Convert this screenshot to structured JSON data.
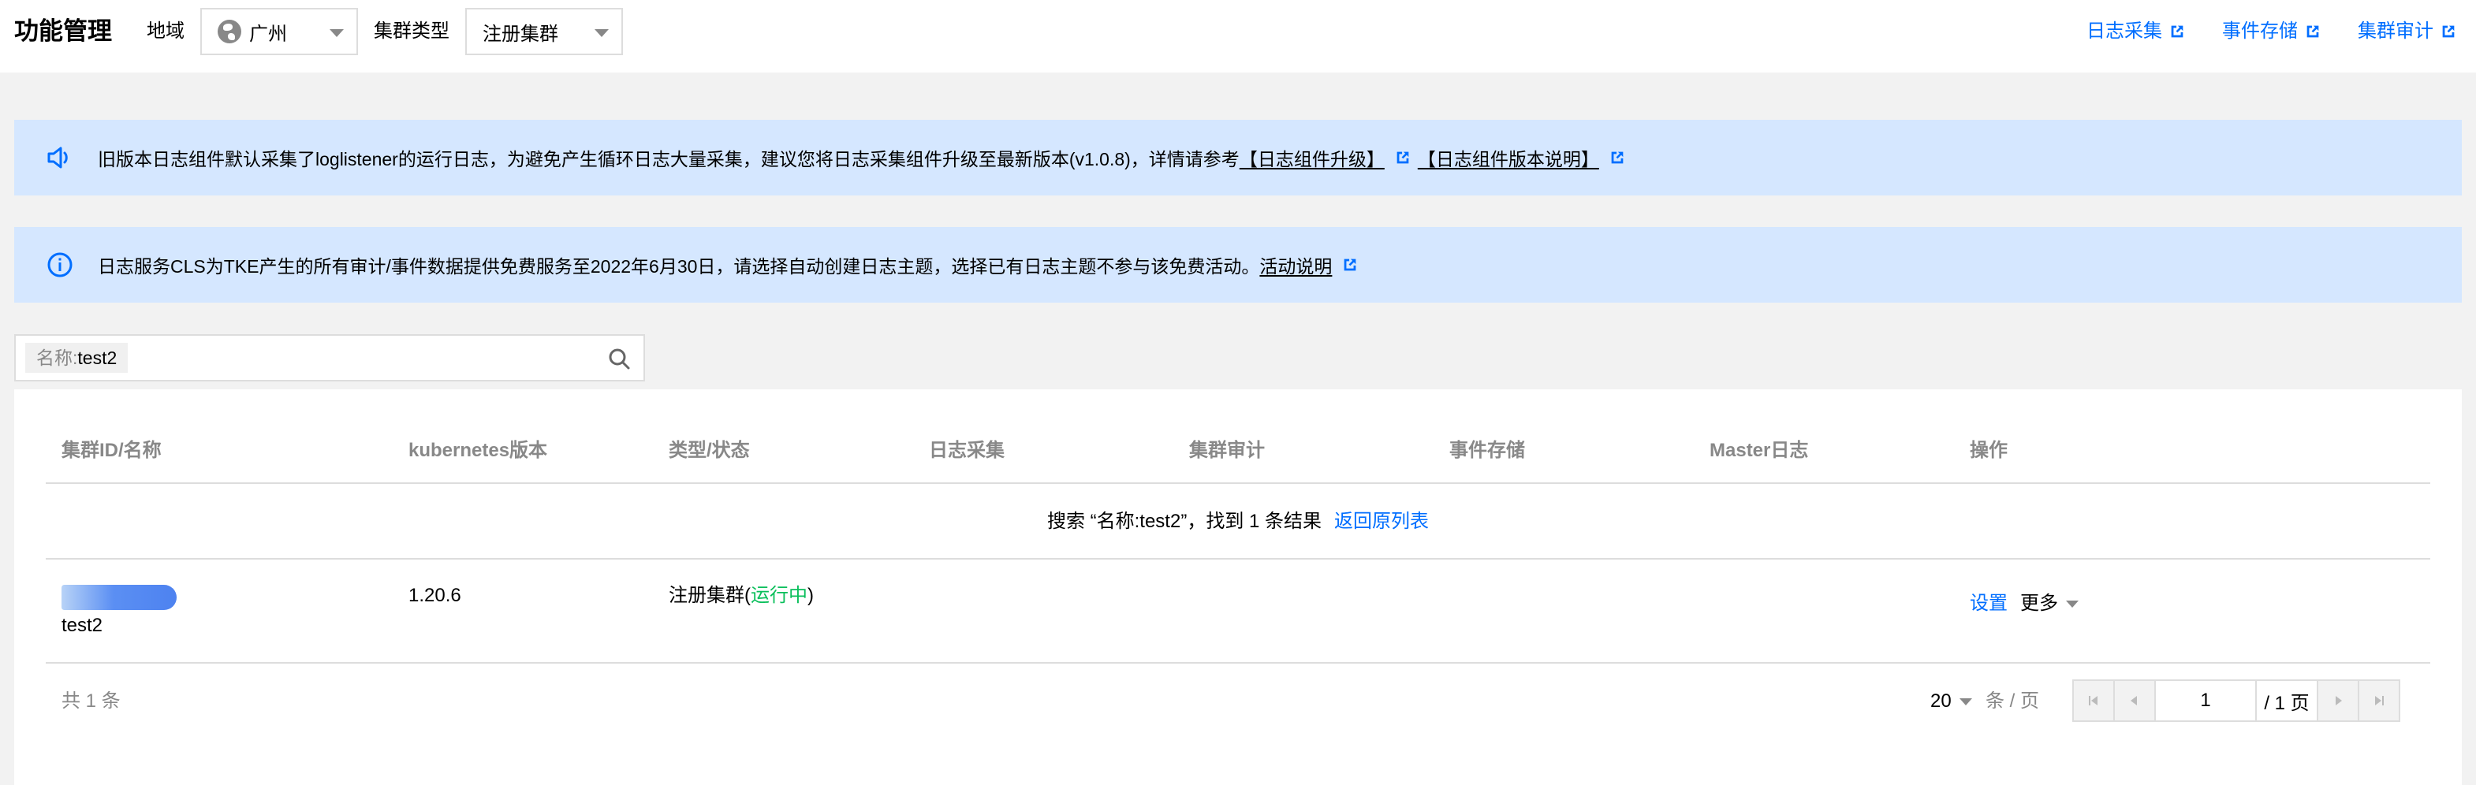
{
  "header": {
    "title": "功能管理",
    "region_label": "地域",
    "region_value": "广州",
    "cluster_type_label": "集群类型",
    "cluster_type_value": "注册集群",
    "links": [
      "日志采集",
      "事件存储",
      "集群审计"
    ]
  },
  "banners": {
    "notice": {
      "text": "旧版本日志组件默认采集了loglistener的运行日志，为避免产生循环日志大量采集，建议您将日志采集组件升级至最新版本(v1.0.8)，详情请参考",
      "link1": "【日志组件升级】",
      "link2": "【日志组件版本说明】"
    },
    "info": {
      "text": "日志服务CLS为TKE产生的所有审计/事件数据提供免费服务至2022年6月30日，请选择自动创建日志主题，选择已有日志主题不参与该免费活动。",
      "link": "活动说明"
    }
  },
  "search": {
    "tag_key": "名称:",
    "tag_value": "test2"
  },
  "table": {
    "columns": [
      "集群ID/名称",
      "kubernetes版本",
      "类型/状态",
      "日志采集",
      "集群审计",
      "事件存储",
      "Master日志",
      "操作"
    ],
    "result_message": "搜索 “名称:test2”，找到 1 条结果",
    "back_link": "返回原列表",
    "rows": [
      {
        "name": "test2",
        "k8s_version": "1.20.6",
        "type": "注册集群(",
        "status": "运行中",
        "type_close": ")",
        "action_settings": "设置",
        "action_more": "更多"
      }
    ]
  },
  "footer": {
    "total": "共 1 条",
    "page_size": "20",
    "page_size_unit": "条 / 页",
    "current_page": "1",
    "total_pages": "/ 1 页"
  },
  "colors": {
    "link": "#006eff",
    "banner_bg": "#d5e7ff",
    "status_running": "#0abf5b",
    "page_bg": "#f2f2f2"
  }
}
